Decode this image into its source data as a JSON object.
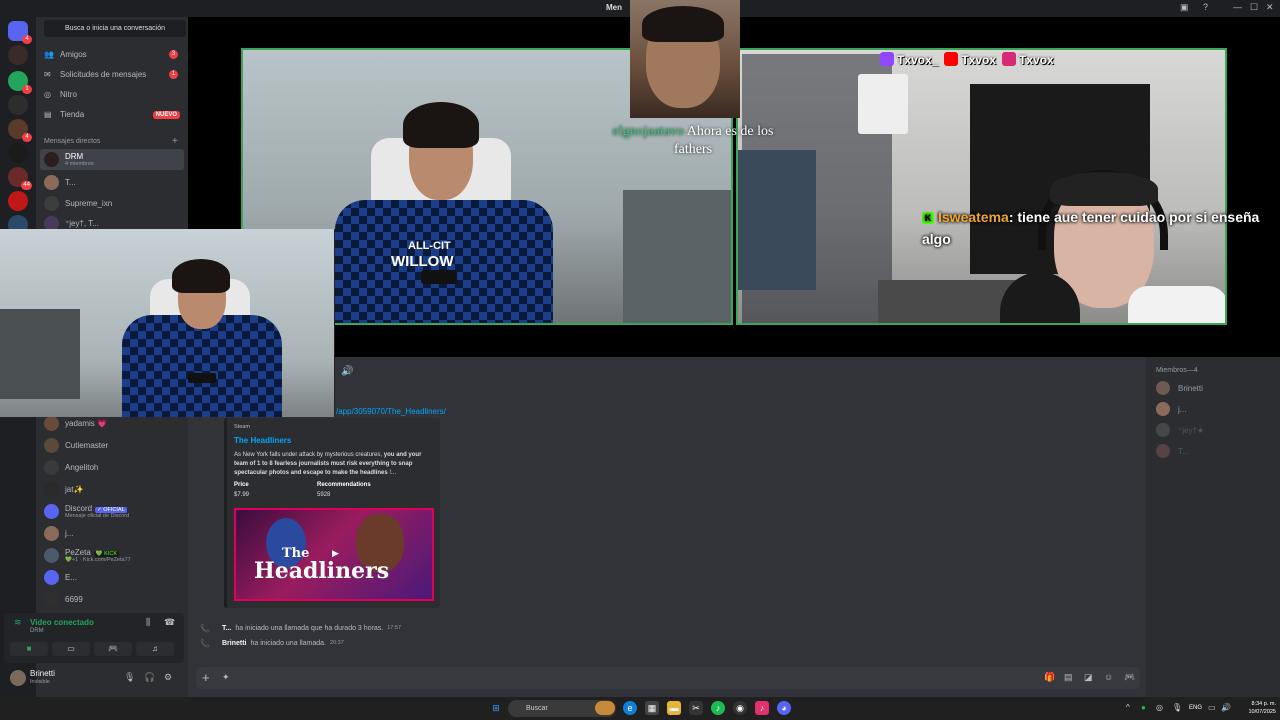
{
  "window": {
    "title": "Men",
    "controls": [
      "—",
      "☐",
      "✕"
    ]
  },
  "servers": {
    "badges": [
      "4",
      "1",
      "4",
      "1",
      "4",
      "44"
    ]
  },
  "sidebar": {
    "search_label": "Busca o inicia una conversación",
    "nav": [
      {
        "label": "Amigos",
        "count": "3"
      },
      {
        "label": "Solicitudes de mensajes",
        "count": "1"
      },
      {
        "label": "Nitro"
      },
      {
        "label": "Tienda",
        "badge": "NUEVO"
      }
    ],
    "dm_header": "Mensajes directos",
    "dms_top": [
      {
        "name": "DRM",
        "sub": "4 miembros"
      },
      {
        "name": "T..."
      },
      {
        "name": "Supreme_ixn"
      },
      {
        "name": "⁺jey†, T..."
      }
    ],
    "dms_bottom": [
      {
        "name": "yadamis 💗"
      },
      {
        "name": "Cutiemaster"
      },
      {
        "name": "Angelitoh"
      },
      {
        "name": "jat✨"
      },
      {
        "name": "Discord",
        "tag": "✓ OFICIAL",
        "sub": "Mensaje oficial de Discord"
      },
      {
        "name": "j..."
      },
      {
        "name": "PeZeta",
        "tag": "💚 KICK",
        "sub": "💚+1 · Kick.com/PeZeta77"
      },
      {
        "name": "E..."
      },
      {
        "name": "6699"
      }
    ]
  },
  "voice": {
    "status": "Video conectado",
    "channel": "DRM"
  },
  "user": {
    "name": "Brinetti",
    "status": "Invisible"
  },
  "stream": {
    "chat_line_1_user": "Isweatema",
    "chat_line_1_text": ": tiene aue tener cuidao por si enseña algo",
    "chat_line_2_user": "elgnojaatavo",
    "chat_line_2_text": "Ahora es de los fathers",
    "socials": [
      "Txvox_",
      "Txvox",
      "Txvox"
    ],
    "jersey_text": "ALL-CIT",
    "jersey_text_2": "WILLOW"
  },
  "chat": {
    "link": "/app/3059070/The_Headliners/",
    "embed": {
      "provider": "Steam",
      "title": "The Headliners",
      "desc_pre": "As New York falls under attack by mysterious creatures, ",
      "desc_bold": "you and your team of 1 to 8 fearless journalists must risk everything to snap spectacular photos and escape to make the headlines",
      "desc_post": " !...",
      "price_label": "Price",
      "price_value": "$7.99",
      "rec_label": "Recommendations",
      "rec_value": "5928",
      "image_line1": "The",
      "image_line2": "Headliners"
    },
    "calls": [
      {
        "user": "T...",
        "text": "ha iniciado una llamada que ha durado 3 horas.",
        "time": "17:57"
      },
      {
        "user": "Brinetti",
        "text": "ha iniciado una llamada.",
        "time": "20:37"
      }
    ]
  },
  "members": {
    "header": "Miembros—4",
    "list": [
      "Brinetti",
      "j...",
      "⁺jey†★",
      "T..."
    ]
  },
  "taskbar": {
    "search": "Buscar",
    "lang": "ENG",
    "time": "8:34 p. m.",
    "date": "10/07/2025"
  },
  "colors": {
    "accent": "#5865f2",
    "online": "#23a55a",
    "danger": "#f23f43",
    "stream_border": "#3ba55c"
  }
}
